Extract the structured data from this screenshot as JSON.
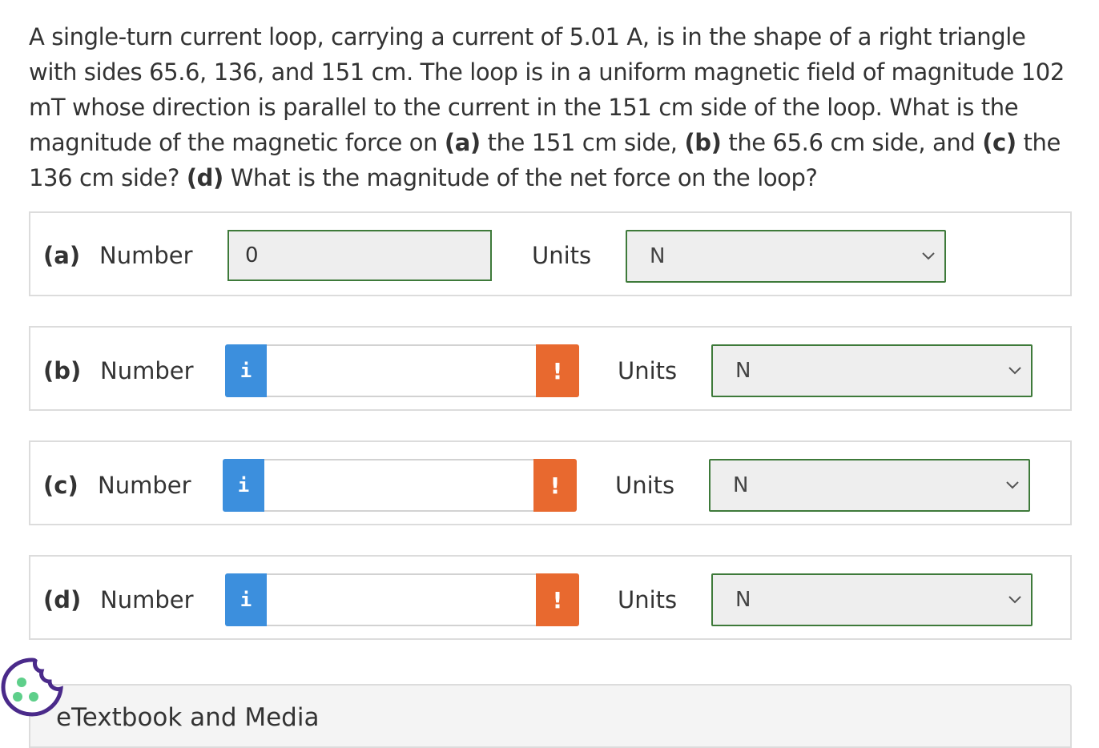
{
  "question": {
    "text1": "A single-turn current loop, carrying a current of 5.01 A, is in the shape of a right triangle with sides 65.6, 136, and 151 cm. The loop is in a uniform magnetic field of magnitude 102 mT whose direction is parallel to the current in the 151 cm side of the loop. What is the magnitude of the magnetic force on ",
    "a": "(a)",
    "text2": " the 151 cm side, ",
    "b": "(b)",
    "text3": " the 65.6 cm side, and ",
    "c": "(c)",
    "text4": " the 136 cm side? ",
    "d": "(d)",
    "text5": " What is the magnitude of the net force on the loop?"
  },
  "parts": [
    {
      "label": "(a)",
      "number_label": "Number",
      "value": "0",
      "units_label": "Units",
      "units": "N"
    },
    {
      "label": "(b)",
      "number_label": "Number",
      "value": "",
      "info": "i",
      "warn": "!",
      "units_label": "Units",
      "units": "N"
    },
    {
      "label": "(c)",
      "number_label": "Number",
      "value": "",
      "info": "i",
      "warn": "!",
      "units_label": "Units",
      "units": "N"
    },
    {
      "label": "(d)",
      "number_label": "Number",
      "value": "",
      "info": "i",
      "warn": "!",
      "units_label": "Units",
      "units": "N"
    }
  ],
  "etextbook": {
    "title": "eTextbook and Media"
  },
  "colors": {
    "info": "#3c8fdd",
    "warn": "#e8692f",
    "border_ok": "#3e7a3a",
    "cookie": "#5ecf8a"
  },
  "icons": {
    "info": "info-icon",
    "warn": "warning-icon",
    "chevron": "chevron-down-icon",
    "cookie": "cookie-icon"
  }
}
